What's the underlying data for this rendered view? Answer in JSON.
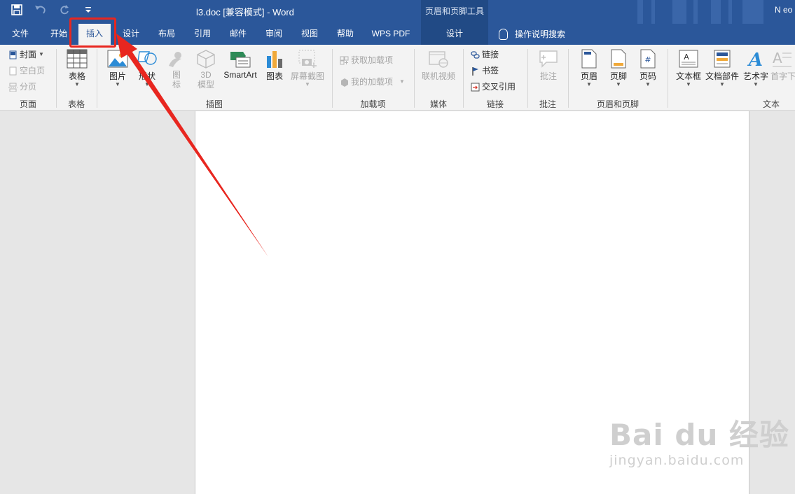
{
  "window": {
    "title": "l3.doc [兼容模式]  -  Word",
    "context_tool": "页眉和页脚工具",
    "user": "N eo"
  },
  "qat": {
    "save_icon": "save-icon",
    "undo_icon": "undo-icon",
    "redo_icon": "redo-icon",
    "customize_icon": "customize-qat-icon"
  },
  "tabs": {
    "file": "文件",
    "home": "开始",
    "insert": "插入",
    "design": "设计",
    "layout": "布局",
    "references": "引用",
    "mailings": "邮件",
    "review": "审阅",
    "view": "视图",
    "help": "帮助",
    "wps_pdf": "WPS PDF",
    "hf_design": "设计",
    "tell_me": "操作说明搜索"
  },
  "ribbon": {
    "pages": {
      "cover": "封面",
      "blank": "空白页",
      "break": "分页",
      "label": "页面"
    },
    "tables": {
      "table": "表格",
      "label": "表格"
    },
    "illustrations": {
      "pictures": "图片",
      "shapes": "形状",
      "icons_1": "图",
      "icons_2": "标",
      "model_1": "3D",
      "model_2": "模型",
      "smartart": "SmartArt",
      "chart": "图表",
      "screenshot": "屏幕截图",
      "label": "插图"
    },
    "addins": {
      "get": "获取加载项",
      "my": "我的加载项",
      "label": "加载项"
    },
    "media": {
      "video": "联机视频",
      "label": "媒体"
    },
    "links": {
      "link": "链接",
      "bookmark": "书签",
      "cross_ref": "交叉引用",
      "label": "链接"
    },
    "comments": {
      "comment": "批注",
      "label": "批注"
    },
    "header_footer": {
      "header": "页眉",
      "footer": "页脚",
      "page_number": "页码",
      "label": "页眉和页脚"
    },
    "text": {
      "textbox": "文本框",
      "quick_parts": "文档部件",
      "wordart": "艺术字",
      "dropcap": "首字下",
      "label": "文本"
    }
  },
  "watermark": {
    "main": "Bai du 经验",
    "sub": "jingyan.baidu.com"
  },
  "colors": {
    "brand": "#2b579a",
    "annotation": "#e8261f"
  }
}
